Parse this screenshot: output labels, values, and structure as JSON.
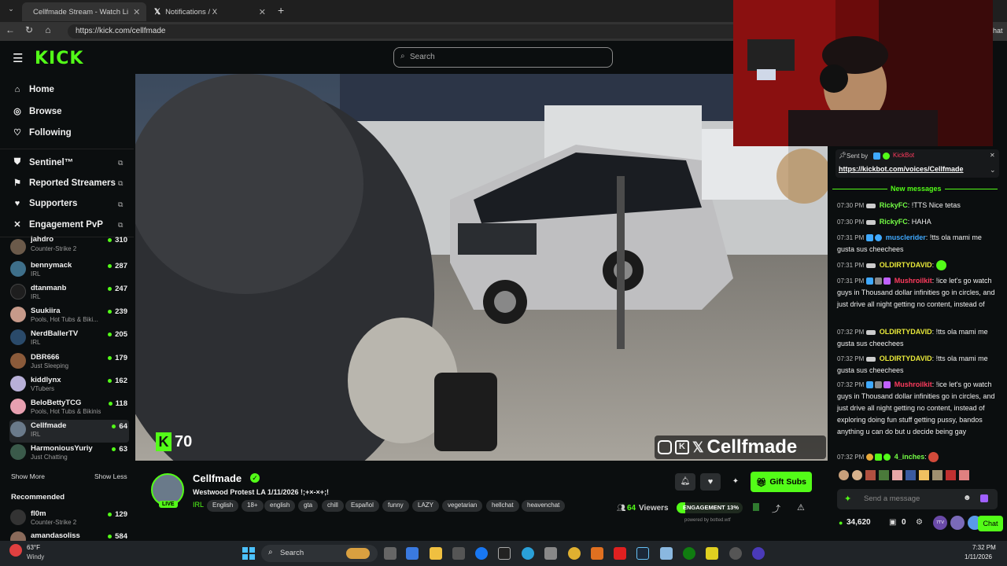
{
  "browser": {
    "tabs": [
      {
        "title": "Cellfmade Stream - Watch Li",
        "active": true
      },
      {
        "title": "Notifications / X",
        "active": false
      }
    ],
    "url": "https://kick.com/cellfmade",
    "new_tab": "+",
    "profile": "hat"
  },
  "header": {
    "logo": "KICK",
    "search_placeholder": "Search"
  },
  "sidebar": {
    "nav": [
      {
        "label": "Home",
        "icon": "home-icon"
      },
      {
        "label": "Browse",
        "icon": "compass-icon"
      },
      {
        "label": "Following",
        "icon": "heart-icon"
      }
    ],
    "extensions": [
      {
        "label": "Sentinel™",
        "icon": "shield-icon"
      },
      {
        "label": "Reported Streamers",
        "icon": "flag-icon"
      },
      {
        "label": "Supporters",
        "icon": "heart-icon"
      },
      {
        "label": "Engagement PvP",
        "icon": "swords-icon"
      }
    ],
    "following": [
      {
        "name": "jahdro",
        "category": "Counter-Strike 2",
        "viewers": "310",
        "color": "#6b5a4a"
      },
      {
        "name": "bennymack",
        "category": "IRL",
        "viewers": "287",
        "color": "#3e6f8a"
      },
      {
        "name": "dtanmanb",
        "category": "IRL",
        "viewers": "247",
        "color": "#1e1e1e"
      },
      {
        "name": "Suukiira",
        "category": "Pools, Hot Tubs & Biki...",
        "viewers": "239",
        "color": "#c79a8a"
      },
      {
        "name": "NerdBallerTV",
        "category": "IRL",
        "viewers": "205",
        "color": "#2a4a6a"
      },
      {
        "name": "DBR666",
        "category": "Just Sleeping",
        "viewers": "179",
        "color": "#8a5a3a"
      },
      {
        "name": "kiddlynx",
        "category": "VTubers",
        "viewers": "162",
        "color": "#b8b0d8"
      },
      {
        "name": "BeloBettyTCG",
        "category": "Pools, Hot Tubs & Bikinis",
        "viewers": "118",
        "color": "#e7a0b0"
      },
      {
        "name": "Cellfmade",
        "category": "IRL",
        "viewers": "64",
        "color": "#6a7a8a"
      },
      {
        "name": "HarmoniousYuriy",
        "category": "Just Chatting",
        "viewers": "63",
        "color": "#3a5a4a"
      }
    ],
    "show_more": "Show More",
    "show_less": "Show Less",
    "recommended_title": "Recommended",
    "recommended": [
      {
        "name": "fl0m",
        "category": "Counter-Strike 2",
        "viewers": "129",
        "color": "#333"
      },
      {
        "name": "amandasoliss",
        "category": "",
        "viewers": "584",
        "color": "#8a6a5a"
      }
    ]
  },
  "video": {
    "kick_overlay_count": "70",
    "watermark": "Cellfmade"
  },
  "stream_info": {
    "channel": "Cellfmade",
    "live_badge": "LIVE",
    "title": "Westwood Protest LA 1/11/2026 !;+×-×+;!",
    "category": "IRL",
    "tags": [
      "English",
      "18+",
      "english",
      "gta",
      "chill",
      "Español",
      "funny",
      "LAZY",
      "vegetarian",
      "hellchat",
      "heavenchat"
    ],
    "gift_subs": "Gift Subs",
    "viewers_count": "64",
    "viewers_label": "Viewers",
    "engagement_label": "ENGAGEMENT",
    "engagement_pct": "13%",
    "powered_by": "powered by botted.wtf"
  },
  "chat": {
    "pinned_sent_by": "Sent by",
    "pinned_sender": "KickBot",
    "pinned_link": "https://kickbot.com/voices/Cellfmade",
    "new_messages": "New messages",
    "messages": [
      {
        "time": "07:30 PM",
        "user": "RickyFC",
        "color": "u-green",
        "text": "!TTS Nice tetas"
      },
      {
        "time": "07:30 PM",
        "user": "RickyFC",
        "color": "u-green",
        "text": "HAHA"
      },
      {
        "time": "07:31 PM",
        "user": "musclerider",
        "color": "u-blue",
        "text": "!tts ola mami me gusta sus cheechees"
      },
      {
        "time": "07:31 PM",
        "user": "OLDIRTYDAVID",
        "color": "u-yellow",
        "text": ""
      },
      {
        "time": "07:31 PM",
        "user": "Mushroilkit",
        "color": "u-red",
        "text": "!ice let's go watch guys in  Thousand dollar infinities go in circles, and just drive all night getting no content, instead of"
      },
      {
        "time": "07:32 PM",
        "user": "OLDIRTYDAVID",
        "color": "u-yellow",
        "text": "!tts ola mami me gusta sus cheechees"
      },
      {
        "time": "07:32 PM",
        "user": "OLDIRTYDAVID",
        "color": "u-yellow",
        "text": "!tts ola mami me gusta sus cheechees"
      },
      {
        "time": "07:32 PM",
        "user": "Mushroilkit",
        "color": "u-red",
        "text": "!ice let's go watch guys in  Thousand dollar infinities go in circles, and just drive all night getting no content, instead of exploring doing fun stuff getting pussy, bandos anything u can do but u decide being gay"
      },
      {
        "time": "07:32 PM",
        "user": "4_inches",
        "color": "u-green",
        "text": ""
      }
    ],
    "input_placeholder": "Send a message",
    "points": "34,620",
    "extra_count": "0",
    "chat_button": "Chat"
  },
  "taskbar": {
    "weather_temp": "63°F",
    "weather_desc": "Windy",
    "search": "Search",
    "time": "7:32 PM",
    "date": "1/11/2026"
  }
}
